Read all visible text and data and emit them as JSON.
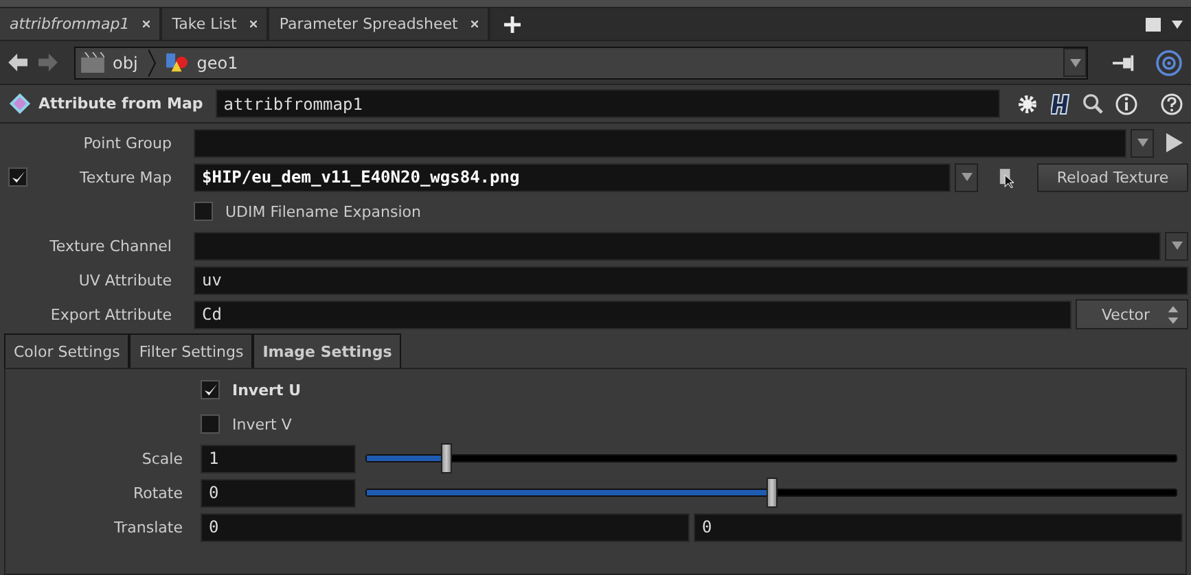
{
  "tabs": [
    {
      "label": "attribfrommap1",
      "selected": true
    },
    {
      "label": "Take List",
      "selected": false
    },
    {
      "label": "Parameter Spreadsheet",
      "selected": false
    }
  ],
  "path": [
    "obj",
    "geo1"
  ],
  "node": {
    "type": "Attribute from Map",
    "name": "attribfrommap1"
  },
  "parameters": [
    {
      "kind": "menu-field",
      "label": "Point Group"
    },
    {
      "kind": "file",
      "label": "Texture Map",
      "enabled": true,
      "value": "$HIP/eu_dem_v11_E40N20_wgs84.png",
      "button": "Reload Texture"
    },
    {
      "kind": "toggle",
      "label": "UDIM Filename Expansion",
      "checked": false
    },
    {
      "kind": "menu-field",
      "label": "Texture Channel"
    },
    {
      "kind": "string",
      "label": "UV Attribute",
      "value": "uv"
    },
    {
      "kind": "string-menu",
      "label": "Export Attribute",
      "value": "Cd",
      "menu": "Vector"
    }
  ],
  "settings_tabs": [
    {
      "label": "Color Settings",
      "selected": false
    },
    {
      "label": "Filter Settings",
      "selected": false
    },
    {
      "label": "Image Settings",
      "selected": true
    }
  ],
  "image_settings": [
    {
      "kind": "toggle",
      "label": "Invert U",
      "checked": true
    },
    {
      "kind": "toggle",
      "label": "Invert V",
      "checked": false
    },
    {
      "kind": "slider",
      "label": "Scale",
      "value": "1",
      "level": 0.1
    },
    {
      "kind": "slider",
      "label": "Rotate",
      "value": "0",
      "level": 0.5
    },
    {
      "kind": "vector2",
      "label": "Translate",
      "values": [
        "0",
        "0"
      ]
    }
  ]
}
